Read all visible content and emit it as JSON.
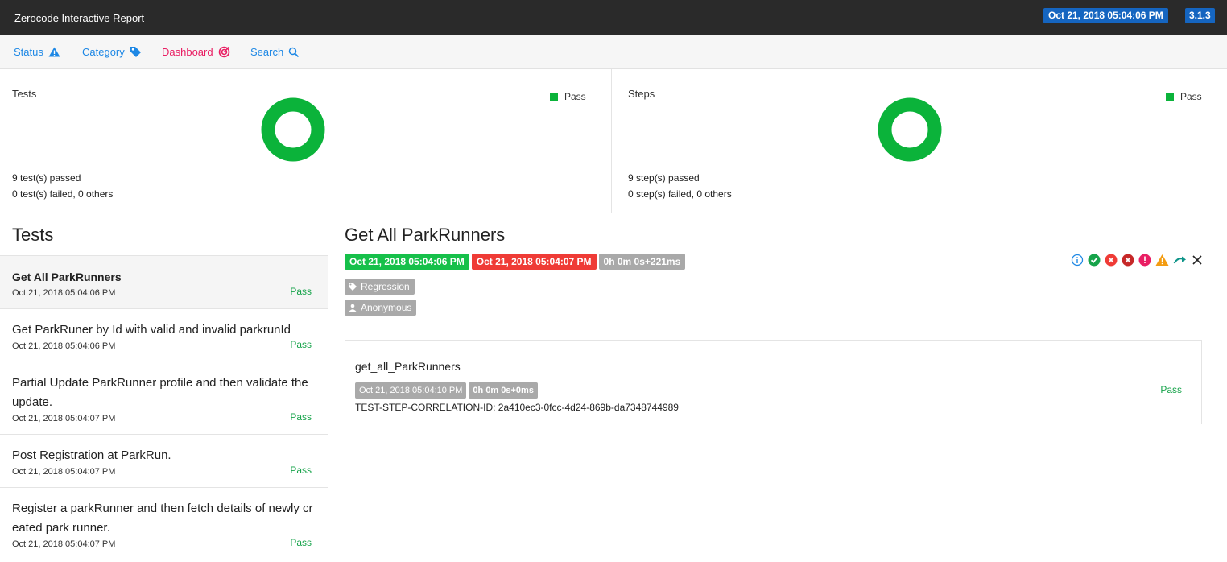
{
  "header": {
    "title": "Zerocode Interactive Report",
    "date": "Oct 21, 2018 05:04:06 PM",
    "version": "3.1.3"
  },
  "nav": {
    "status": "Status",
    "category": "Category",
    "dashboard": "Dashboard",
    "search": "Search"
  },
  "summary": {
    "tests": {
      "title": "Tests",
      "legend": "Pass",
      "passed_line": "9 test(s) passed",
      "failed_line": "0 test(s) failed, 0 others",
      "pass_fraction": 1.0
    },
    "steps": {
      "title": "Steps",
      "legend": "Pass",
      "passed_line": "9 step(s) passed",
      "failed_line": "0 step(s) failed, 0 others",
      "pass_fraction": 1.0
    },
    "pass_color": "#0bb33a"
  },
  "tests_panel": {
    "heading": "Tests",
    "items": [
      {
        "name": "Get All ParkRunners",
        "time": "Oct 21, 2018 05:04:06 PM",
        "status": "Pass"
      },
      {
        "name": "Get ParkRuner by Id with valid and invalid parkrunId",
        "time": "Oct 21, 2018 05:04:06 PM",
        "status": "Pass"
      },
      {
        "name": "Partial Update ParkRunner profile and then validate the update.",
        "time": "Oct 21, 2018 05:04:07 PM",
        "status": "Pass"
      },
      {
        "name": "Post Registration at ParkRun.",
        "time": "Oct 21, 2018 05:04:07 PM",
        "status": "Pass"
      },
      {
        "name": "Register a parkRunner and then fetch details of newly created park runner.",
        "time": "Oct 21, 2018 05:04:07 PM",
        "status": "Pass"
      }
    ]
  },
  "detail": {
    "title": "Get All ParkRunners",
    "start_time": "Oct 21, 2018 05:04:06 PM",
    "end_time": "Oct 21, 2018 05:04:07 PM",
    "duration": "0h 0m 0s+221ms",
    "category": "Regression",
    "author": "Anonymous",
    "step": {
      "name": "get_all_ParkRunners",
      "time": "Oct 21, 2018 05:04:10 PM",
      "duration": "0h 0m 0s+0ms",
      "correlation": "TEST-STEP-CORRELATION-ID: 2a410ec3-0fcc-4d24-869b-da7348744989",
      "status": "Pass"
    }
  }
}
